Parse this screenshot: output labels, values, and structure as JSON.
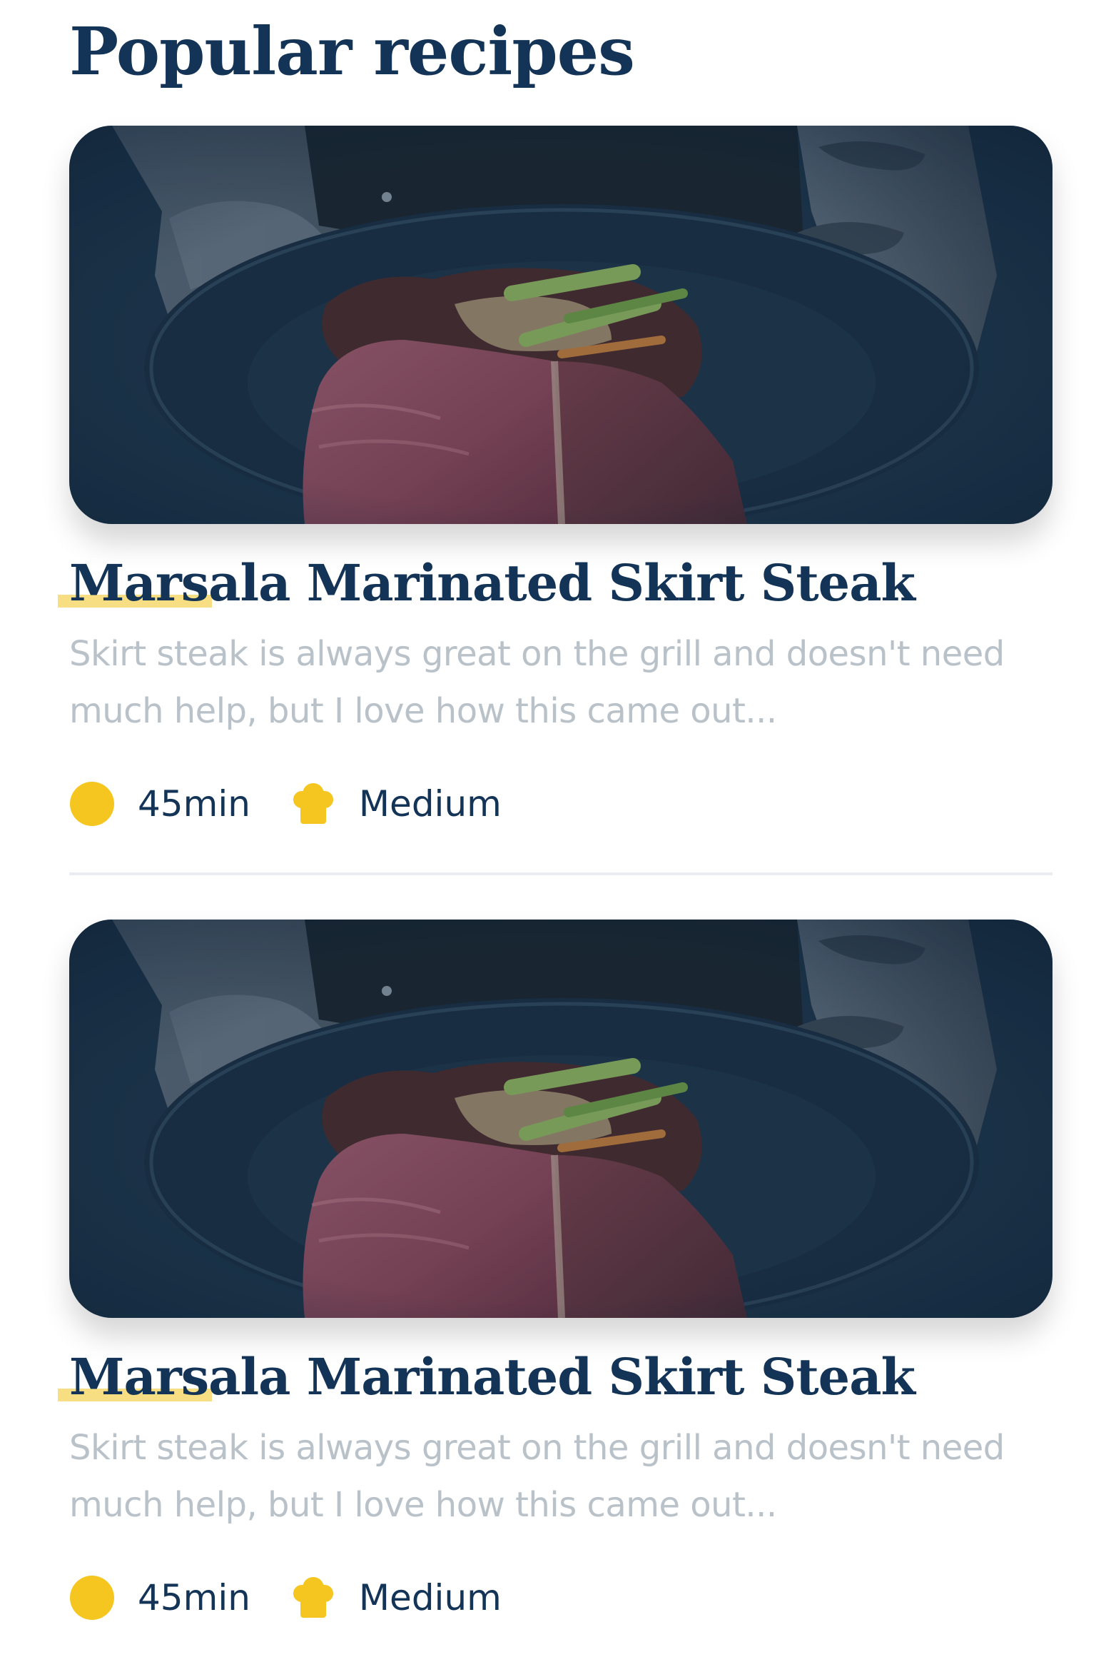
{
  "page": {
    "title": "Popular recipes"
  },
  "recipes": [
    {
      "title": "Marsala Marinated Skirt Steak",
      "description": "Skirt steak is always great on the grill and doesn't need much help, but I love how this came out...",
      "time": "45min",
      "difficulty": "Medium",
      "time_icon": "clock-icon",
      "difficulty_icon": "chef-hat-icon"
    },
    {
      "title": "Marsala Marinated Skirt Steak",
      "description": "Skirt steak is always great on the grill and doesn't need much help, but I love how this came out...",
      "time": "45min",
      "difficulty": "Medium",
      "time_icon": "clock-icon",
      "difficulty_icon": "chef-hat-icon"
    }
  ],
  "colors": {
    "heading": "#133456",
    "accent_yellow": "#f4c61f",
    "underline_highlight": "#f8de83",
    "description_text": "#b9c1c9",
    "divider": "#e9edf1"
  }
}
